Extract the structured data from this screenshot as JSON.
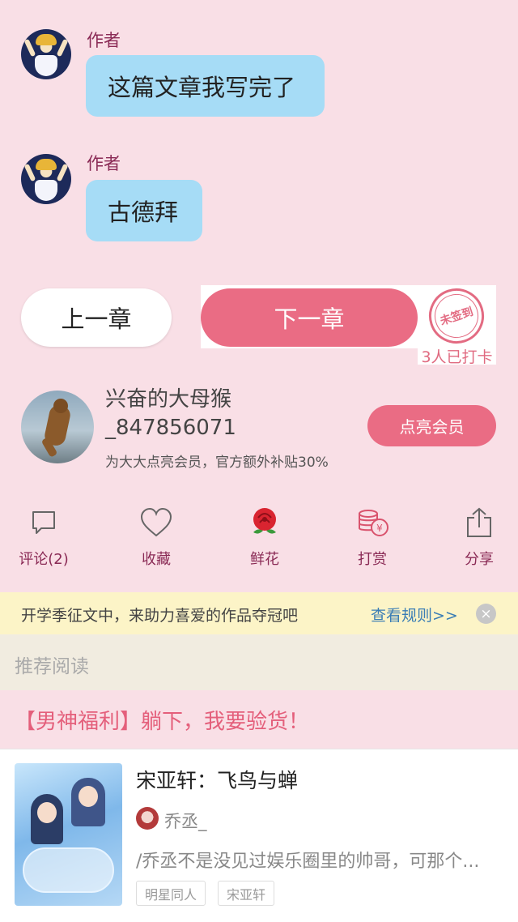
{
  "chat": [
    {
      "author_label": "作者",
      "message": "这篇文章我写完了"
    },
    {
      "author_label": "作者",
      "message": "古德拜"
    }
  ],
  "chapter_nav": {
    "prev_label": "上一章",
    "next_label": "下一章",
    "stamp_text": "未签到",
    "checkin_count_text": "3人已打卡"
  },
  "member": {
    "username_line1": "兴奋的大母猴",
    "username_line2": "_847856071",
    "subtitle": "为大大点亮会员，官方额外补贴30%",
    "vip_button": "点亮会员"
  },
  "actions": [
    {
      "label": "评论(2)",
      "icon": "comment-icon"
    },
    {
      "label": "收藏",
      "icon": "heart-icon"
    },
    {
      "label": "鲜花",
      "icon": "rose-icon"
    },
    {
      "label": "打赏",
      "icon": "coins-icon"
    },
    {
      "label": "分享",
      "icon": "share-icon"
    }
  ],
  "banner": {
    "text": "开学季征文中，来助力喜爱的作品夺冠吧",
    "link": "查看规则>>",
    "close_glyph": "×"
  },
  "recommend": {
    "label": "推荐阅读",
    "promo": "【男神福利】躺下，我要验货！",
    "book": {
      "title": "宋亚轩：飞鸟与蝉",
      "author": "乔丞_",
      "description": "/乔丞不是没见过娱乐圈里的帅哥，可那个...",
      "tags": [
        "明星同人",
        "宋亚轩"
      ]
    }
  },
  "colors": {
    "background": "#f9dfe6",
    "accent": "#ea6c84",
    "bubble": "#a6dcf6",
    "label": "#8a2a55",
    "banner": "#fcf4c7"
  }
}
